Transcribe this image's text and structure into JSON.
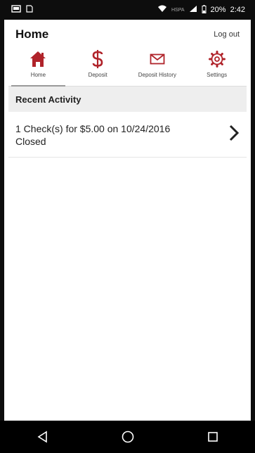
{
  "status_bar": {
    "network_label": "HSPA",
    "battery": "20%",
    "time": "2:42"
  },
  "header": {
    "title": "Home",
    "logout_label": "Log out"
  },
  "nav": {
    "items": [
      {
        "label": "Home",
        "icon": "home-icon",
        "active": true
      },
      {
        "label": "Deposit",
        "icon": "dollar-icon",
        "active": false
      },
      {
        "label": "Deposit History",
        "icon": "envelope-icon",
        "active": false
      },
      {
        "label": "Settings",
        "icon": "gear-icon",
        "active": false
      }
    ]
  },
  "recent_activity": {
    "title": "Recent Activity",
    "items": [
      {
        "line1": "1 Check(s) for $5.00 on 10/24/2016",
        "line2": "Closed"
      }
    ]
  },
  "colors": {
    "accent": "#b0232a",
    "bar": "#0d0d0d"
  }
}
